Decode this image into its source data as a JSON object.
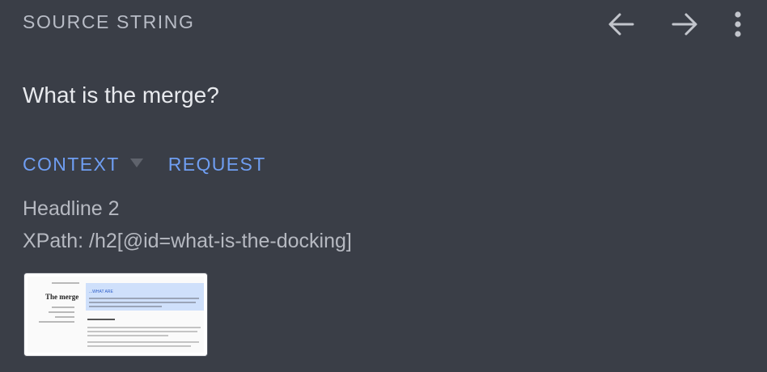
{
  "header": {
    "title": "SOURCE STRING"
  },
  "toolbar": {
    "icons": [
      "arrow-left-icon",
      "arrow-right-icon",
      "more-vertical-icon"
    ]
  },
  "source": {
    "text": "What is the merge?"
  },
  "tabs": [
    {
      "label": "CONTEXT",
      "has_dropdown": true
    },
    {
      "label": "REQUEST",
      "has_dropdown": false
    }
  ],
  "context": {
    "element_type": "Headline 2",
    "xpath": "XPath: /h2[@id=what-is-the-docking]"
  },
  "screenshot_thumbnail": {
    "side_title": "The merge",
    "banner_title": "...WHAT ARE"
  },
  "colors": {
    "background": "#3a3e47",
    "header_text": "#b8bcc6",
    "primary_text": "#e8eaee",
    "accent": "#6f9ef2",
    "secondary_text": "#b6b9c1"
  }
}
